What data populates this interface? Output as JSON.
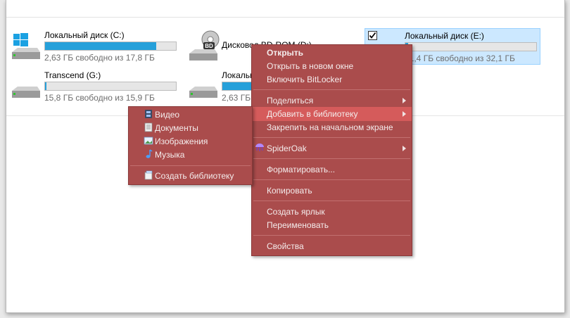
{
  "drives": [
    {
      "name": "Локальный диск (C:)",
      "free": "2,63 ГБ свободно из 17,8 ГБ",
      "used": 0.85,
      "icon": "windows-drive-icon"
    },
    {
      "name": "Дисковод BD-ROM (D:)",
      "icon": "bd-rom-drive-icon"
    },
    {
      "name": "Локальный диск (E:)",
      "free": "31,4 ГБ свободно из 32,1 ГБ",
      "used": 0.02,
      "icon": "hard-drive-icon"
    },
    {
      "name": "Transcend (G:)",
      "free": "15,8 ГБ свободно из 15,9 ГБ",
      "used": 0.01,
      "icon": "hard-drive-icon"
    },
    {
      "name": "Локальный диск (X:)",
      "free": "2,63 ГБ свободно из 17,8 ГБ",
      "used": 0.85,
      "icon": "hard-drive-icon"
    }
  ],
  "context_menu": {
    "open": "Открыть",
    "open_new_window": "Открыть в новом окне",
    "bitlocker": "Включить BitLocker",
    "share": "Поделиться",
    "add_to_library": "Добавить в библиотеку",
    "pin_start": "Закрепить на начальном экране",
    "spideroak": "SpiderOak",
    "format": "Форматировать...",
    "copy": "Копировать",
    "create_shortcut": "Создать ярлык",
    "rename": "Переименовать",
    "properties": "Свойства"
  },
  "library_submenu": {
    "video": "Видео",
    "documents": "Документы",
    "images": "Изображения",
    "music": "Музыка",
    "create_library": "Создать библиотеку"
  },
  "colors": {
    "menu_bg": "#aa4c4c",
    "menu_highlight": "#d55b5b",
    "progress": "#26a0da",
    "selection": "#cce8ff"
  }
}
